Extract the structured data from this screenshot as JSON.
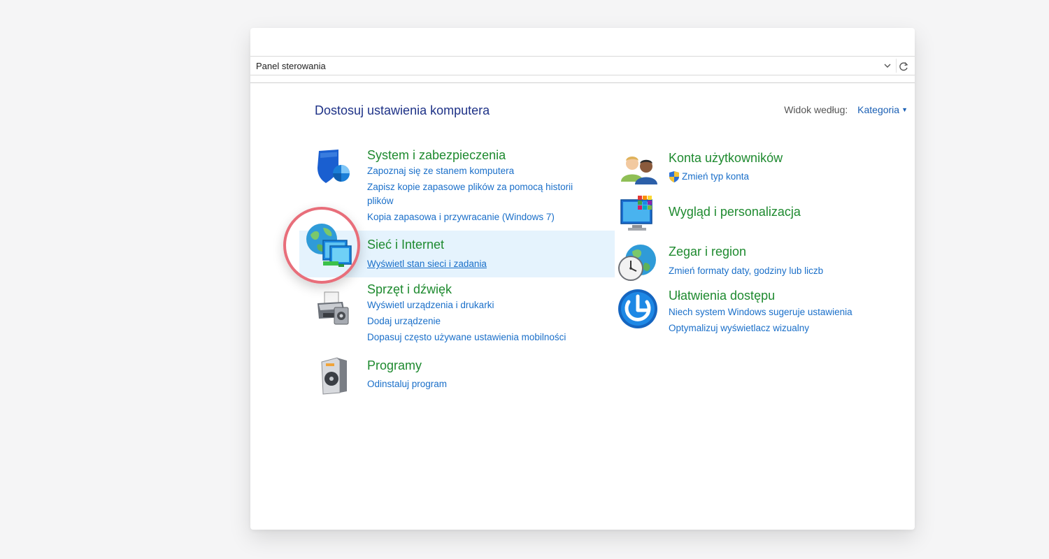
{
  "address_bar": {
    "path": "Panel sterowania"
  },
  "header": {
    "title": "Dostosuj ustawienia komputera",
    "view_by_label": "Widok według:",
    "view_by_value": "Kategoria"
  },
  "left_categories": [
    {
      "title": "System i zabezpieczenia",
      "links": [
        "Zapoznaj się ze stanem komputera",
        "Zapisz kopie zapasowe plików za pomocą historii",
        "plików",
        "Kopia zapasowa i przywracanie (Windows 7)"
      ]
    },
    {
      "title": "Sieć i Internet",
      "links": [
        "Wyświetl stan sieci i zadania"
      ]
    },
    {
      "title": "Sprzęt i dźwięk",
      "links": [
        "Wyświetl urządzenia i drukarki",
        "Dodaj urządzenie",
        "Dopasuj często używane ustawienia mobilności"
      ]
    },
    {
      "title": "Programy",
      "links": [
        "Odinstaluj program"
      ]
    }
  ],
  "right_categories": [
    {
      "title": "Konta użytkowników",
      "links": [
        "Zmień typ konta"
      ]
    },
    {
      "title": "Wygląd i personalizacja",
      "links": []
    },
    {
      "title": "Zegar i region",
      "links": [
        "Zmień formaty daty, godziny lub liczb"
      ]
    },
    {
      "title": "Ułatwienia dostępu",
      "links": [
        "Niech system Windows sugeruje ustawienia",
        "Optymalizuj wyświetlacz wizualny"
      ]
    }
  ],
  "colors": {
    "title_blue": "#1e3287",
    "category_green": "#1e8a2f",
    "link_blue": "#1a6fc9",
    "highlight": "#e5f3fd",
    "ring": "#e86e7a"
  }
}
